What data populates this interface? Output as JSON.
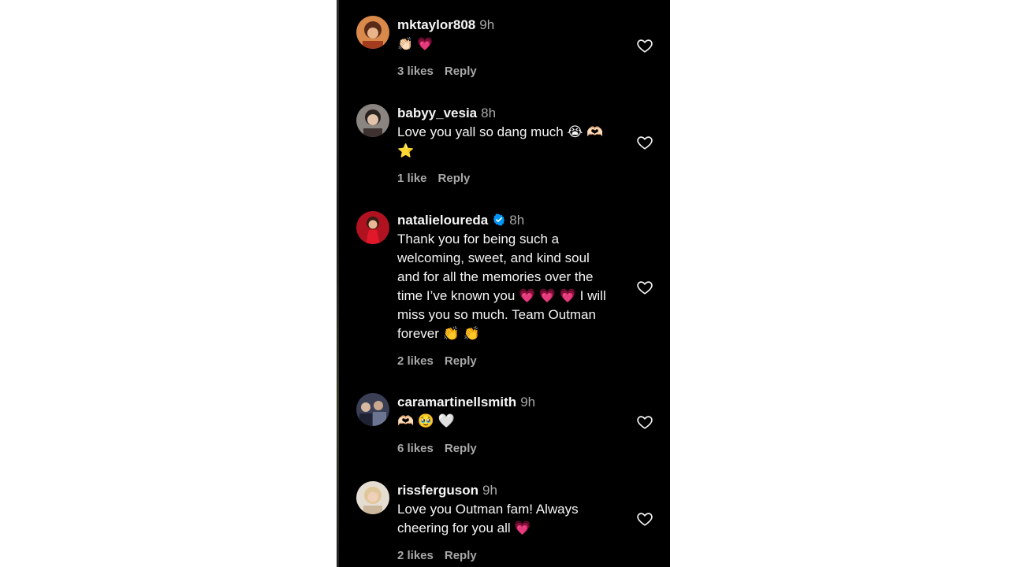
{
  "comments": [
    {
      "username": "mktaylor808",
      "time": "9h",
      "text": "👏🏻 💗",
      "likes": "3 likes",
      "reply": "Reply",
      "avatar_color": "#b04a2a"
    },
    {
      "username": "babyy_vesia",
      "time": "8h",
      "text": "Love you yall so dang much 😭 🫶🏻\n⭐",
      "likes": "1 like",
      "reply": "Reply",
      "avatar_color": "#7a6a60"
    },
    {
      "username": "natalieloureda",
      "time": "8h",
      "verified": true,
      "text": "Thank you for being such a\nwelcoming, sweet, and kind soul\nand for all the memories over the\ntime I’ve known you 💗 💗 💗  I will\nmiss you so much. Team Outman\nforever  👏  👏",
      "likes": "2 likes",
      "reply": "Reply",
      "avatar_color": "#c8102e"
    },
    {
      "username": "caramartinellsmith",
      "time": "9h",
      "text": "🫶🏻 🥹 🤍",
      "likes": "6 likes",
      "reply": "Reply",
      "avatar_color": "#3a3f55"
    },
    {
      "username": "rissferguson",
      "time": "9h",
      "text": "Love you Outman fam! Always\ncheering for you all  💗",
      "likes": "2 likes",
      "reply": "Reply",
      "avatar_color": "#d9c2a6"
    }
  ],
  "colors": {
    "background": "#000000",
    "text": "#f5f5f5",
    "secondary_text": "#a8a8a8",
    "verified_badge": "#0095f6",
    "heart_emoji": "#ff3b6b"
  },
  "icons": {
    "like": "heart-outline-icon",
    "verified": "verified-badge-icon"
  }
}
